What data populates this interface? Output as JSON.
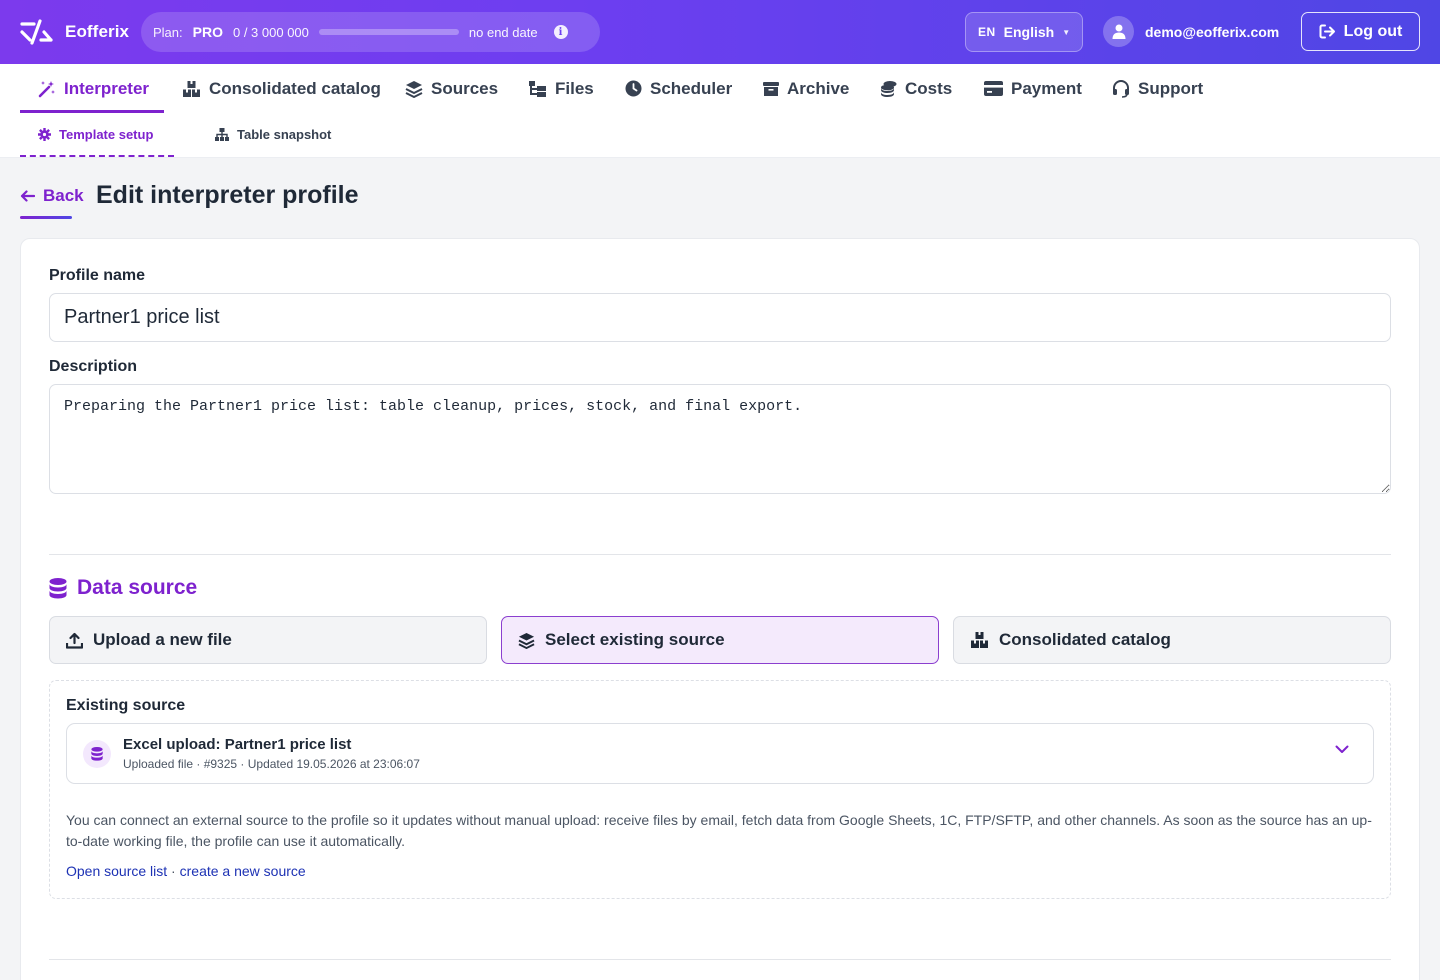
{
  "app": {
    "name": "Eofferix"
  },
  "plan": {
    "label": "Plan:",
    "name": "PRO",
    "usage": "0 / 3 000 000",
    "usage_fraction": 0,
    "end": "no end date"
  },
  "lang": {
    "code": "EN",
    "name": "English"
  },
  "user": {
    "email": "demo@eofferix.com"
  },
  "logout": {
    "label": "Log out"
  },
  "nav": {
    "items": [
      {
        "label": "Interpreter",
        "icon": "magic-wand-icon",
        "active": true
      },
      {
        "label": "Consolidated catalog",
        "icon": "boxes-icon"
      },
      {
        "label": "Sources",
        "icon": "layers-icon"
      },
      {
        "label": "Files",
        "icon": "folder-tree-icon"
      },
      {
        "label": "Scheduler",
        "icon": "clock-icon"
      },
      {
        "label": "Archive",
        "icon": "archive-box-icon"
      },
      {
        "label": "Costs",
        "icon": "coins-icon"
      },
      {
        "label": "Payment",
        "icon": "credit-card-icon"
      },
      {
        "label": "Support",
        "icon": "headset-icon"
      }
    ],
    "sub": [
      {
        "label": "Template setup",
        "icon": "gear-icon",
        "active": true
      },
      {
        "label": "Table snapshot",
        "icon": "sitemap-icon"
      }
    ]
  },
  "page": {
    "back": "Back",
    "title": "Edit interpreter profile"
  },
  "form": {
    "profile_name_label": "Profile name",
    "profile_name_value": "Partner1 price list",
    "description_label": "Description",
    "description_value": "Preparing the Partner1 price list: table cleanup, prices, stock, and final export."
  },
  "data_source": {
    "title": "Data source",
    "options": [
      {
        "label": "Upload a new file",
        "icon": "upload-icon"
      },
      {
        "label": "Select existing source",
        "icon": "layers-icon",
        "selected": true
      },
      {
        "label": "Consolidated catalog",
        "icon": "boxes-icon"
      }
    ],
    "existing_label": "Existing source",
    "selected_title": "Excel upload: Partner1 price list",
    "selected_meta": "Uploaded file · #9325 · Updated 19.05.2026 at 23:06:07",
    "help": "You can connect an external source to the profile so it updates without manual upload: receive files by email, fetch data from Google Sheets, 1C, FTP/SFTP, and other channels. As soon as the source has an up-to-date working file, the profile can use it automatically.",
    "link_list": "Open source list",
    "link_separator": " · ",
    "link_create": "create a new source"
  },
  "colors": {
    "accent": "#7e22ce",
    "header_start": "#7c3aed",
    "header_end": "#4f46e5",
    "link": "#1d32b4"
  }
}
